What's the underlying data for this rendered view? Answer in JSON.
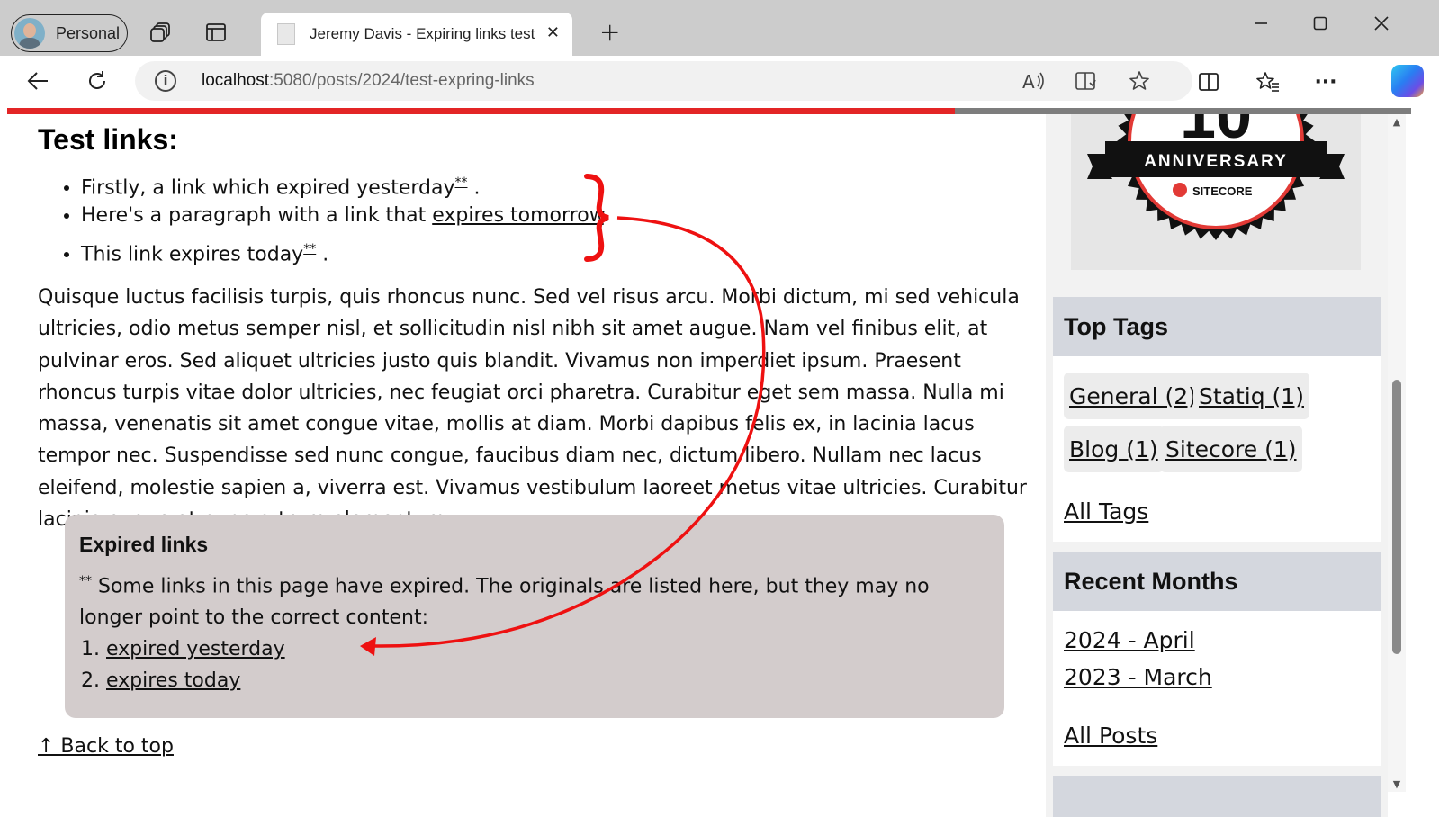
{
  "browser": {
    "profile_label": "Personal",
    "tab_title": "Jeremy Davis - Expiring links test",
    "url_host": "localhost",
    "url_rest": ":5080/posts/2024/test-expring-links",
    "reading_progress": 0.675
  },
  "article": {
    "heading": "Test links:",
    "list": [
      {
        "before": "Firstly, a link which expired yesterday",
        "link": "",
        "marker": "**",
        "after": " ."
      },
      {
        "before": "Here's a paragraph with a link that ",
        "link": "expires tomorrow",
        "marker": "",
        "after": "."
      },
      {
        "before": "This link expires today",
        "link": "",
        "marker": "**",
        "after": " ."
      }
    ],
    "paragraph": "Quisque luctus facilisis turpis, quis rhoncus nunc. Sed vel risus arcu. Morbi dictum, mi sed vehicula ultricies, odio metus semper nisl, et sollicitudin nisl nibh sit amet augue. Nam vel finibus elit, at pulvinar eros. Sed aliquet ultricies justo quis blandit. Vivamus non imperdiet ipsum. Praesent rhoncus turpis vitae dolor ultricies, nec feugiat orci pharetra. Curabitur eget sem massa. Nulla mi massa, venenatis sit amet congue vitae, mollis at diam. Morbi dapibus felis ex, in lacinia lacus tempor nec. Suspendisse sed nunc congue, faucibus diam nec, dictum libero. Nullam nec lacus eleifend, molestie sapien a, viverra est. Vivamus vestibulum laoreet metus vitae ultricies. Curabitur lacinia augue at nunc rutrum elementum.",
    "expired_box": {
      "title": "Expired links",
      "marker": "**",
      "text": " Some links in this page have expired. The originals are listed here, but they may no longer point to the correct content:",
      "links": [
        "expired yesterday",
        "expires today"
      ]
    },
    "back_to_top": "↑ Back to top"
  },
  "sidebar": {
    "logo": {
      "line1": "ANNIVERSARY",
      "line2": "SITECORE",
      "partial_digits": "10"
    },
    "top_tags": {
      "title": "Top Tags",
      "tags": [
        "General (2)",
        "Statiq (1)",
        "Blog (1)",
        "Sitecore (1)"
      ],
      "all_label": "All Tags"
    },
    "recent_months": {
      "title": "Recent Months",
      "months": [
        "2024 - April",
        "2023 - March"
      ],
      "all_label": "All Posts"
    }
  },
  "colors": {
    "progress_fill": "#e32526",
    "annotation": "#ee1111",
    "expired_box_bg": "#d3cccc",
    "panel_header_bg": "#d4d7de"
  }
}
